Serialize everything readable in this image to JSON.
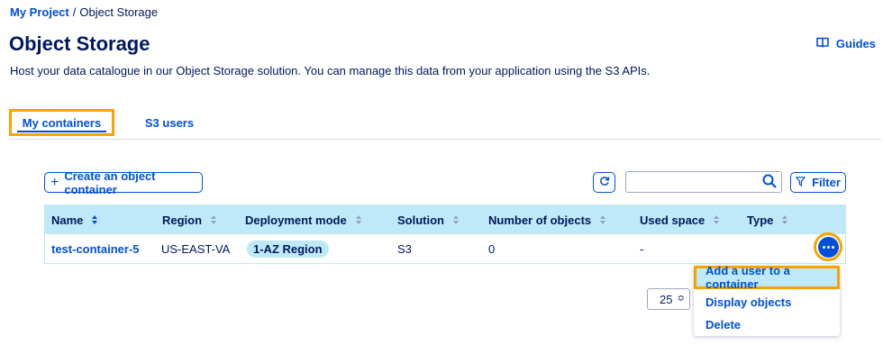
{
  "breadcrumb": {
    "project": "My Project",
    "separator": "/",
    "current": "Object Storage"
  },
  "header": {
    "title": "Object Storage",
    "guides_label": "Guides",
    "guides_icon": "book-icon",
    "description": "Host your data catalogue in our Object Storage solution. You can manage this data from your application using the S3 APIs."
  },
  "tabs": [
    {
      "label": "My containers",
      "active": true
    },
    {
      "label": "S3 users",
      "active": false
    }
  ],
  "toolbar": {
    "create_plus": "+",
    "create_label": "Create an object container",
    "refresh_icon": "refresh-icon",
    "search_value": "",
    "search_icon": "search-icon",
    "filter_label": "Filter",
    "filter_icon": "filter-icon"
  },
  "table": {
    "columns": [
      "Name",
      "Region",
      "Deployment mode",
      "Solution",
      "Number of objects",
      "Used space",
      "Type"
    ],
    "rows": [
      {
        "name": "test-container-5",
        "region": "US-EAST-VA",
        "deployment_mode": "1-AZ Region",
        "solution": "S3",
        "objects": "0",
        "used_space": "-",
        "type": ""
      }
    ]
  },
  "pagination": {
    "page_size": "25",
    "arrows": "≎"
  },
  "action_menu": {
    "items": [
      "Add a user to a container",
      "Display objects",
      "Delete"
    ]
  },
  "colors": {
    "primary": "#0050d7",
    "text": "#00185e",
    "header_bg": "#bfe9f8",
    "highlight": "#f7a400"
  }
}
